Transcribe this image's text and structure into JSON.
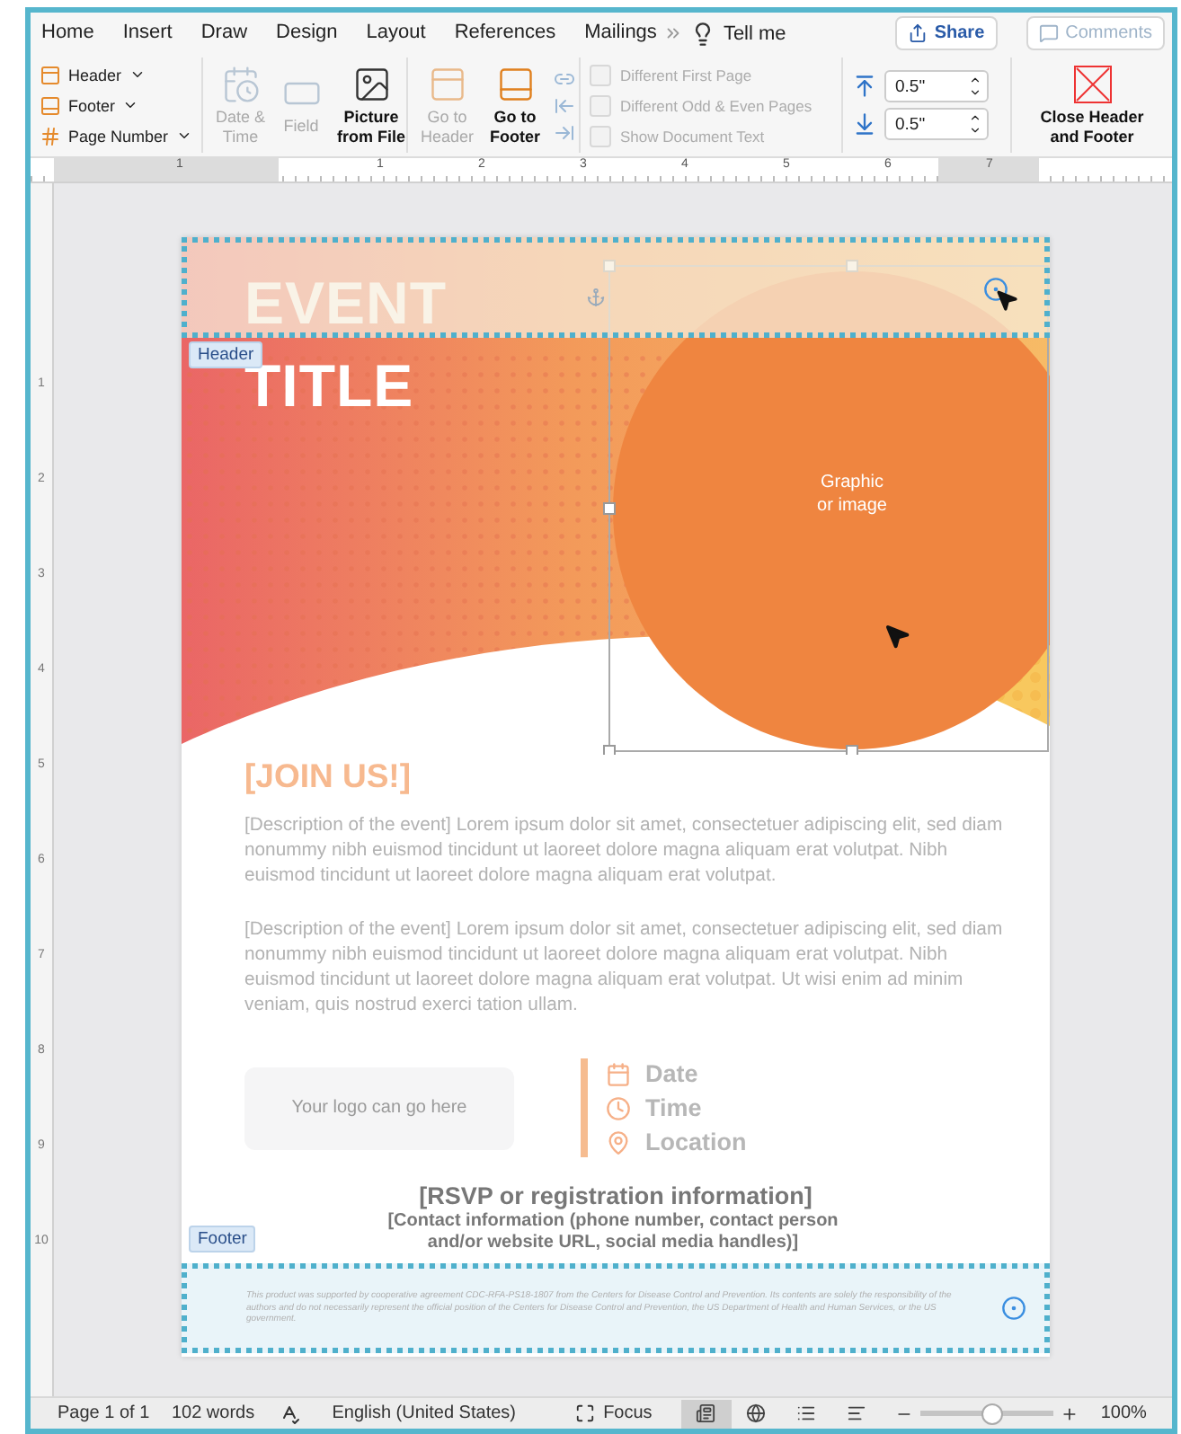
{
  "menu_tabs": [
    {
      "label": "Home",
      "selected": false
    },
    {
      "label": "Insert",
      "selected": false
    },
    {
      "label": "Draw",
      "selected": false
    },
    {
      "label": "Design",
      "selected": false
    },
    {
      "label": "Layout",
      "selected": false
    },
    {
      "label": "References",
      "selected": false
    },
    {
      "label": "Mailings",
      "selected": false
    }
  ],
  "tell_me": "Tell me",
  "share_button": "Share",
  "comments_button": {
    "label": "Comments",
    "disabled": true
  },
  "ribbon": {
    "header_footer_menus": [
      {
        "kind": "header",
        "label": "Header"
      },
      {
        "kind": "footer",
        "label": "Footer"
      },
      {
        "kind": "page_number",
        "label": "Page Number"
      }
    ],
    "insert_buttons": [
      {
        "kind": "date",
        "label": "Date &\nTime",
        "disabled": true
      },
      {
        "kind": "field",
        "label": "Field",
        "disabled": true
      },
      {
        "kind": "picture",
        "label": "Picture\nfrom File",
        "disabled": false
      }
    ],
    "navigation_buttons": [
      {
        "kind": "header",
        "label": "Go to\nHeader",
        "disabled": true
      },
      {
        "kind": "footer",
        "label": "Go to\nFooter",
        "disabled": false
      }
    ],
    "options": [
      {
        "label": "Different First Page",
        "checked": false,
        "disabled": true
      },
      {
        "label": "Different Odd & Even Pages",
        "checked": false,
        "disabled": true
      },
      {
        "label": "Show Document Text",
        "checked": false,
        "disabled": true
      }
    ],
    "positions": [
      {
        "kind": "header",
        "value": "0.5\""
      },
      {
        "kind": "footer",
        "value": "0.5\""
      }
    ],
    "close_button": "Close Header\nand Footer"
  },
  "horizontal_ruler": [
    "1",
    "1",
    "2",
    "3",
    "4",
    "5",
    "6",
    "7"
  ],
  "vertical_ruler": [
    "1",
    "2",
    "3",
    "4",
    "5",
    "6",
    "7",
    "8",
    "9",
    "10"
  ],
  "document": {
    "header_tag": "Header",
    "event_title": "EVENT\nTITLE",
    "graphic_label": "Graphic\nor image",
    "heading": "[JOIN US!]",
    "paragraphs": [
      "[Description of the event] Lorem ipsum dolor sit amet, consectetuer adipiscing elit, sed diam nonummy nibh euismod tincidunt ut laoreet dolore magna aliquam erat volutpat. Nibh euismod tincidunt ut laoreet dolore magna aliquam erat volutpat.",
      "[Description of the event] Lorem ipsum dolor sit amet, consectetuer adipiscing elit, sed diam nonummy nibh euismod tincidunt ut laoreet dolore magna aliquam erat volutpat. Nibh euismod tincidunt ut laoreet dolore magna aliquam erat volutpat. Ut wisi enim ad minim veniam, quis nostrud exerci tation ullam."
    ],
    "logo_placeholder": "Your logo can go here",
    "details": [
      {
        "kind": "date",
        "label": "Date"
      },
      {
        "kind": "time",
        "label": "Time"
      },
      {
        "kind": "location",
        "label": "Location"
      }
    ],
    "rsvp": "[RSVP or registration information]",
    "contact": "[Contact information (phone number, contact person and/or website URL, social media handles)]",
    "footer_tag": "Footer",
    "footer_text": "This product was supported by cooperative agreement CDC-RFA-PS18-1807 from the Centers for Disease Control and Prevention. Its contents are solely the responsibility of the authors and do not necessarily represent the official position of the Centers for Disease Control and Prevention, the US Department of Health and Human Services, or the US government."
  },
  "status_bar": {
    "page": "Page 1 of 1",
    "words": "102 words",
    "language": "English (United States)",
    "focus": "Focus",
    "views": [
      {
        "kind": "print",
        "selected": true
      },
      {
        "kind": "web",
        "selected": false
      },
      {
        "kind": "outline",
        "selected": false
      },
      {
        "kind": "draft",
        "selected": false
      }
    ],
    "zoom": {
      "level": 0.53,
      "reading": "100%"
    }
  }
}
